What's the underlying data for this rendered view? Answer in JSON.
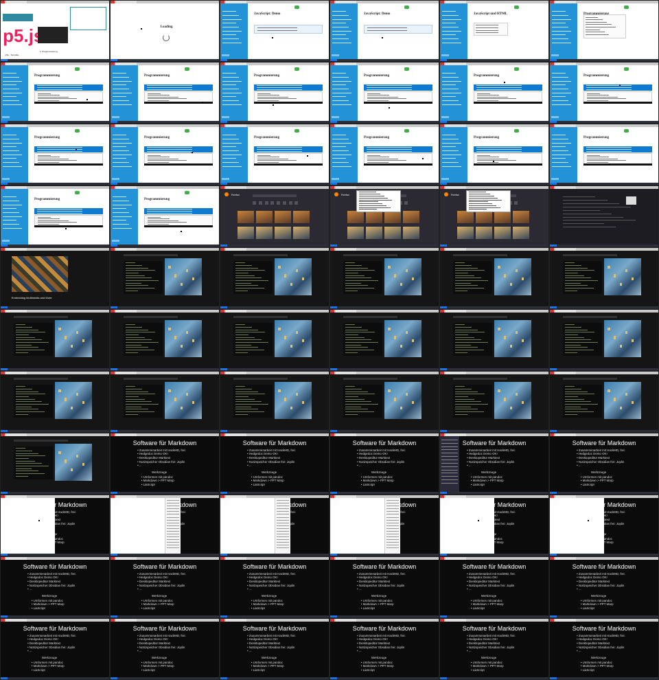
{
  "app": {
    "title": ""
  },
  "texts": {
    "p5_logo": "p5.js",
    "p5_template": "p5js - Template",
    "p5_programmierung": "2. Programmierung",
    "loading": "Loading",
    "javascript_demo": "JavaScript: Demo",
    "javascript_html": "JavaScript und HTML",
    "programmierung": "Programmierung",
    "firefox": "Firefox",
    "embedding": "Embedding Multimedia and More",
    "slide_title": "Software für Markdown",
    "slide_items": [
      "Zusammenarbeit mit HackMD, frei:",
      "Hedgedoc Demo OK!",
      "Desktopeditor Marktext",
      "Notizspeicher Obsidian frei: Joplin",
      "..."
    ],
    "werkzeuge": "Werkzeuge",
    "tools": [
      "Umformen mit pandoc",
      "Markdown > PPT Marp",
      "LiaScript"
    ]
  },
  "tiles": [
    {
      "type": "p5"
    },
    {
      "type": "loading"
    },
    {
      "type": "doc",
      "title": "javascript_demo",
      "variant": "demo"
    },
    {
      "type": "doc",
      "title": "javascript_demo",
      "variant": "demo2"
    },
    {
      "type": "doc",
      "title": "javascript_html",
      "variant": "html"
    },
    {
      "type": "doc",
      "title": "programmierung",
      "variant": "code"
    },
    {
      "type": "doc",
      "title": "programmierung",
      "variant": "prog"
    },
    {
      "type": "doc",
      "title": "programmierung",
      "variant": "prog"
    },
    {
      "type": "doc",
      "title": "programmierung",
      "variant": "prog"
    },
    {
      "type": "doc",
      "title": "programmierung",
      "variant": "prog"
    },
    {
      "type": "doc",
      "title": "programmierung",
      "variant": "prog"
    },
    {
      "type": "doc",
      "title": "programmierung",
      "variant": "prog"
    },
    {
      "type": "doc",
      "title": "programmierung",
      "variant": "prog"
    },
    {
      "type": "doc",
      "title": "programmierung",
      "variant": "prog"
    },
    {
      "type": "doc",
      "title": "programmierung",
      "variant": "prog"
    },
    {
      "type": "doc",
      "title": "programmierung",
      "variant": "prog"
    },
    {
      "type": "doc",
      "title": "programmierung",
      "variant": "prog"
    },
    {
      "type": "doc",
      "title": "programmierung",
      "variant": "prog"
    },
    {
      "type": "doc",
      "title": "programmierung",
      "variant": "prog"
    },
    {
      "type": "doc",
      "title": "programmierung",
      "variant": "prog"
    },
    {
      "type": "firefox"
    },
    {
      "type": "firefox",
      "menu": true
    },
    {
      "type": "firefox",
      "menu": true
    },
    {
      "type": "darkdoc"
    },
    {
      "type": "collage"
    },
    {
      "type": "darkcode"
    },
    {
      "type": "darkcode"
    },
    {
      "type": "darkcode"
    },
    {
      "type": "darkcode"
    },
    {
      "type": "darkcode"
    },
    {
      "type": "darkcode"
    },
    {
      "type": "darkcode"
    },
    {
      "type": "darkcode"
    },
    {
      "type": "darkcode"
    },
    {
      "type": "darkcode"
    },
    {
      "type": "darkcode"
    },
    {
      "type": "darkcode"
    },
    {
      "type": "darkcode"
    },
    {
      "type": "darkcode"
    },
    {
      "type": "darkcode"
    },
    {
      "type": "darkcode"
    },
    {
      "type": "darkcode"
    },
    {
      "type": "darkcode"
    },
    {
      "type": "slide"
    },
    {
      "type": "slide"
    },
    {
      "type": "slide"
    },
    {
      "type": "slide",
      "overlay": "menu"
    },
    {
      "type": "slide"
    },
    {
      "type": "slide",
      "overlay": "white"
    },
    {
      "type": "slide",
      "overlay": "white2"
    },
    {
      "type": "slide",
      "overlay": "white2"
    },
    {
      "type": "slide",
      "overlay": "white2"
    },
    {
      "type": "slide",
      "overlay": "white"
    },
    {
      "type": "slide",
      "overlay": "white"
    },
    {
      "type": "slide"
    },
    {
      "type": "slide"
    },
    {
      "type": "slide"
    },
    {
      "type": "slide"
    },
    {
      "type": "slide"
    },
    {
      "type": "slide"
    },
    {
      "type": "slide"
    },
    {
      "type": "slide"
    },
    {
      "type": "slide"
    },
    {
      "type": "slide"
    },
    {
      "type": "slide"
    },
    {
      "type": "slide"
    }
  ]
}
